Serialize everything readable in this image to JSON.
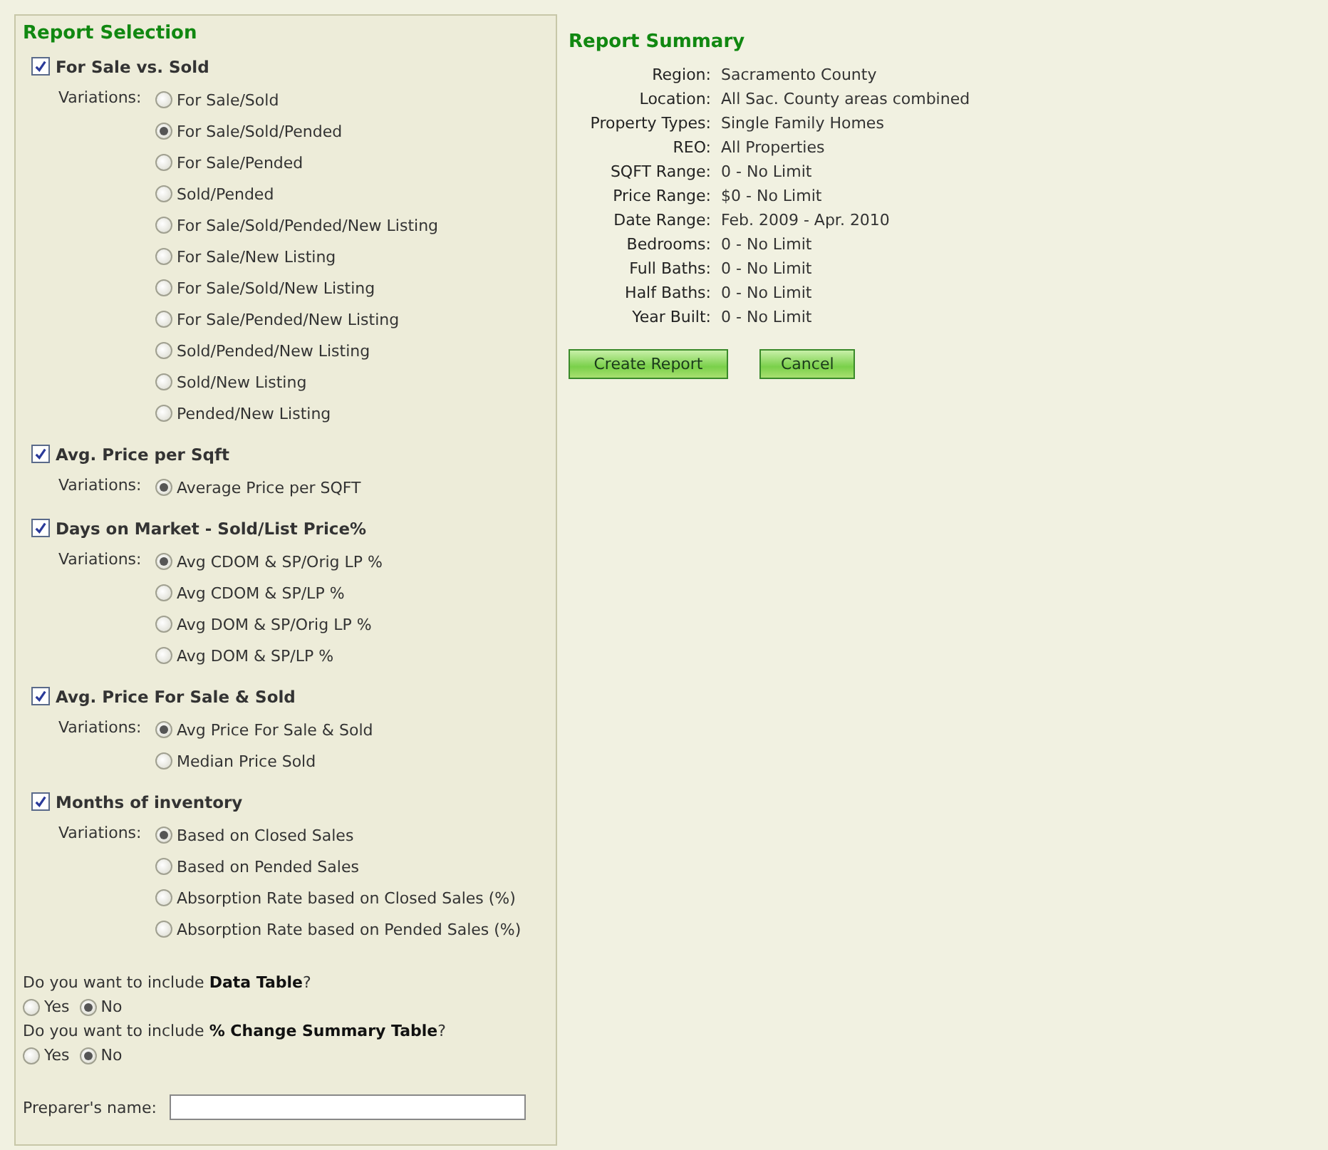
{
  "selection": {
    "title": "Report Selection",
    "sections": [
      {
        "label": "For Sale vs. Sold",
        "checked": true,
        "variations_label": "Variations:",
        "options": [
          {
            "label": "For Sale/Sold",
            "selected": false
          },
          {
            "label": "For Sale/Sold/Pended",
            "selected": true
          },
          {
            "label": "For Sale/Pended",
            "selected": false
          },
          {
            "label": "Sold/Pended",
            "selected": false
          },
          {
            "label": "For Sale/Sold/Pended/New Listing",
            "selected": false
          },
          {
            "label": "For Sale/New Listing",
            "selected": false
          },
          {
            "label": "For Sale/Sold/New Listing",
            "selected": false
          },
          {
            "label": "For Sale/Pended/New Listing",
            "selected": false
          },
          {
            "label": "Sold/Pended/New Listing",
            "selected": false
          },
          {
            "label": "Sold/New Listing",
            "selected": false
          },
          {
            "label": "Pended/New Listing",
            "selected": false
          }
        ]
      },
      {
        "label": "Avg. Price per Sqft",
        "checked": true,
        "variations_label": "Variations:",
        "options": [
          {
            "label": "Average Price per SQFT",
            "selected": true
          }
        ]
      },
      {
        "label": "Days on Market - Sold/List Price%",
        "checked": true,
        "variations_label": "Variations:",
        "options": [
          {
            "label": "Avg CDOM & SP/Orig LP %",
            "selected": true
          },
          {
            "label": "Avg CDOM & SP/LP %",
            "selected": false
          },
          {
            "label": "Avg DOM & SP/Orig LP %",
            "selected": false
          },
          {
            "label": "Avg DOM & SP/LP %",
            "selected": false
          }
        ]
      },
      {
        "label": "Avg. Price For Sale & Sold",
        "checked": true,
        "variations_label": "Variations:",
        "options": [
          {
            "label": "Avg Price For Sale & Sold",
            "selected": true
          },
          {
            "label": "Median Price Sold",
            "selected": false
          }
        ]
      },
      {
        "label": "Months of inventory",
        "checked": true,
        "variations_label": "Variations:",
        "options": [
          {
            "label": "Based on Closed Sales",
            "selected": true
          },
          {
            "label": "Based on Pended Sales",
            "selected": false
          },
          {
            "label": "Absorption Rate based on Closed Sales (%)",
            "selected": false
          },
          {
            "label": "Absorption Rate based on Pended Sales (%)",
            "selected": false
          }
        ]
      }
    ],
    "questions": [
      {
        "text": "Do you want to include **Data Table**?",
        "options": [
          {
            "label": "Yes",
            "selected": false
          },
          {
            "label": "No",
            "selected": true
          }
        ]
      },
      {
        "text": "Do you want to include **% Change Summary Table**?",
        "options": [
          {
            "label": "Yes",
            "selected": false
          },
          {
            "label": "No",
            "selected": true
          }
        ]
      }
    ],
    "preparer_label": "Preparer's name:"
  },
  "summary": {
    "title": "Report Summary",
    "rows": [
      {
        "label": "Region:",
        "value": "Sacramento County"
      },
      {
        "label": "Location:",
        "value": "All Sac. County areas combined"
      },
      {
        "label": "Property Types:",
        "value": "Single Family Homes"
      },
      {
        "label": "REO:",
        "value": "All Properties"
      },
      {
        "label": "SQFT Range:",
        "value": "0 - No Limit"
      },
      {
        "label": "Price Range:",
        "value": "$0 - No Limit"
      },
      {
        "label": "Date Range:",
        "value": "Feb. 2009 - Apr. 2010"
      },
      {
        "label": "Bedrooms:",
        "value": "0 - No Limit"
      },
      {
        "label": "Full Baths:",
        "value": "0 - No Limit"
      },
      {
        "label": "Half Baths:",
        "value": "0 - No Limit"
      },
      {
        "label": "Year Built:",
        "value": "0 - No Limit"
      }
    ],
    "buttons": [
      "Create Report",
      "Cancel"
    ]
  }
}
